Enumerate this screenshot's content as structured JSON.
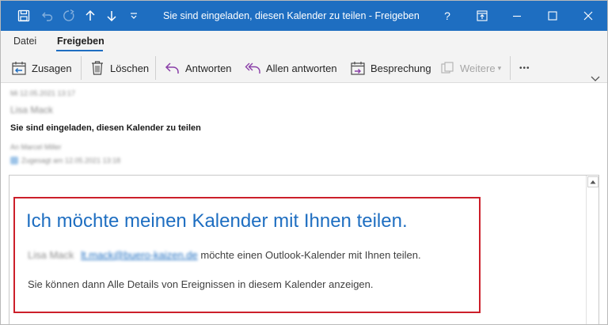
{
  "window": {
    "title": "Sie sind eingeladen, diesen Kalender zu teilen  -  Freigeben",
    "help": "?"
  },
  "icons": {
    "save": "save-icon",
    "undo": "undo-icon",
    "redo": "redo-icon",
    "up": "arrow-up-icon",
    "down": "arrow-down-icon",
    "customize": "customize-quick-access-icon",
    "ribbon_display": "ribbon-display-options-icon",
    "minimize": "minimize-icon",
    "maximize": "maximize-icon",
    "close": "close-icon"
  },
  "tabs": [
    {
      "label": "Datei",
      "active": false
    },
    {
      "label": "Freigeben",
      "active": true
    }
  ],
  "ribbon": {
    "accept": "Zusagen",
    "delete": "Löschen",
    "reply": "Antworten",
    "reply_all": "Allen antworten",
    "meeting": "Besprechung",
    "more": "Weitere",
    "overflow": "•••"
  },
  "colors": {
    "accent": "#1e6ec1",
    "highlight_border": "#cc1f2a",
    "reply_icon": "#8a3fa8"
  },
  "header": {
    "date_blurred": "Mi 12.05.2021 13:17",
    "sender_blurred": "Lisa Mack",
    "subject": "Sie sind eingeladen, diesen Kalender zu teilen",
    "to_blurred": "An   Marcel Miller",
    "accepted_blurred": "Zugesagt am 12.05.2021 13:18"
  },
  "body": {
    "heading": "Ich möchte meinen Kalender mit Ihnen teilen.",
    "sender_name_blurred": "Lisa Mack",
    "sender_email_blurred": "lt.mack@buero-kaizen.de",
    "line1_suffix": " möchte einen Outlook-Kalender mit Ihnen teilen.",
    "line2": "Sie können dann Alle Details von Ereignissen in diesem Kalender anzeigen."
  }
}
